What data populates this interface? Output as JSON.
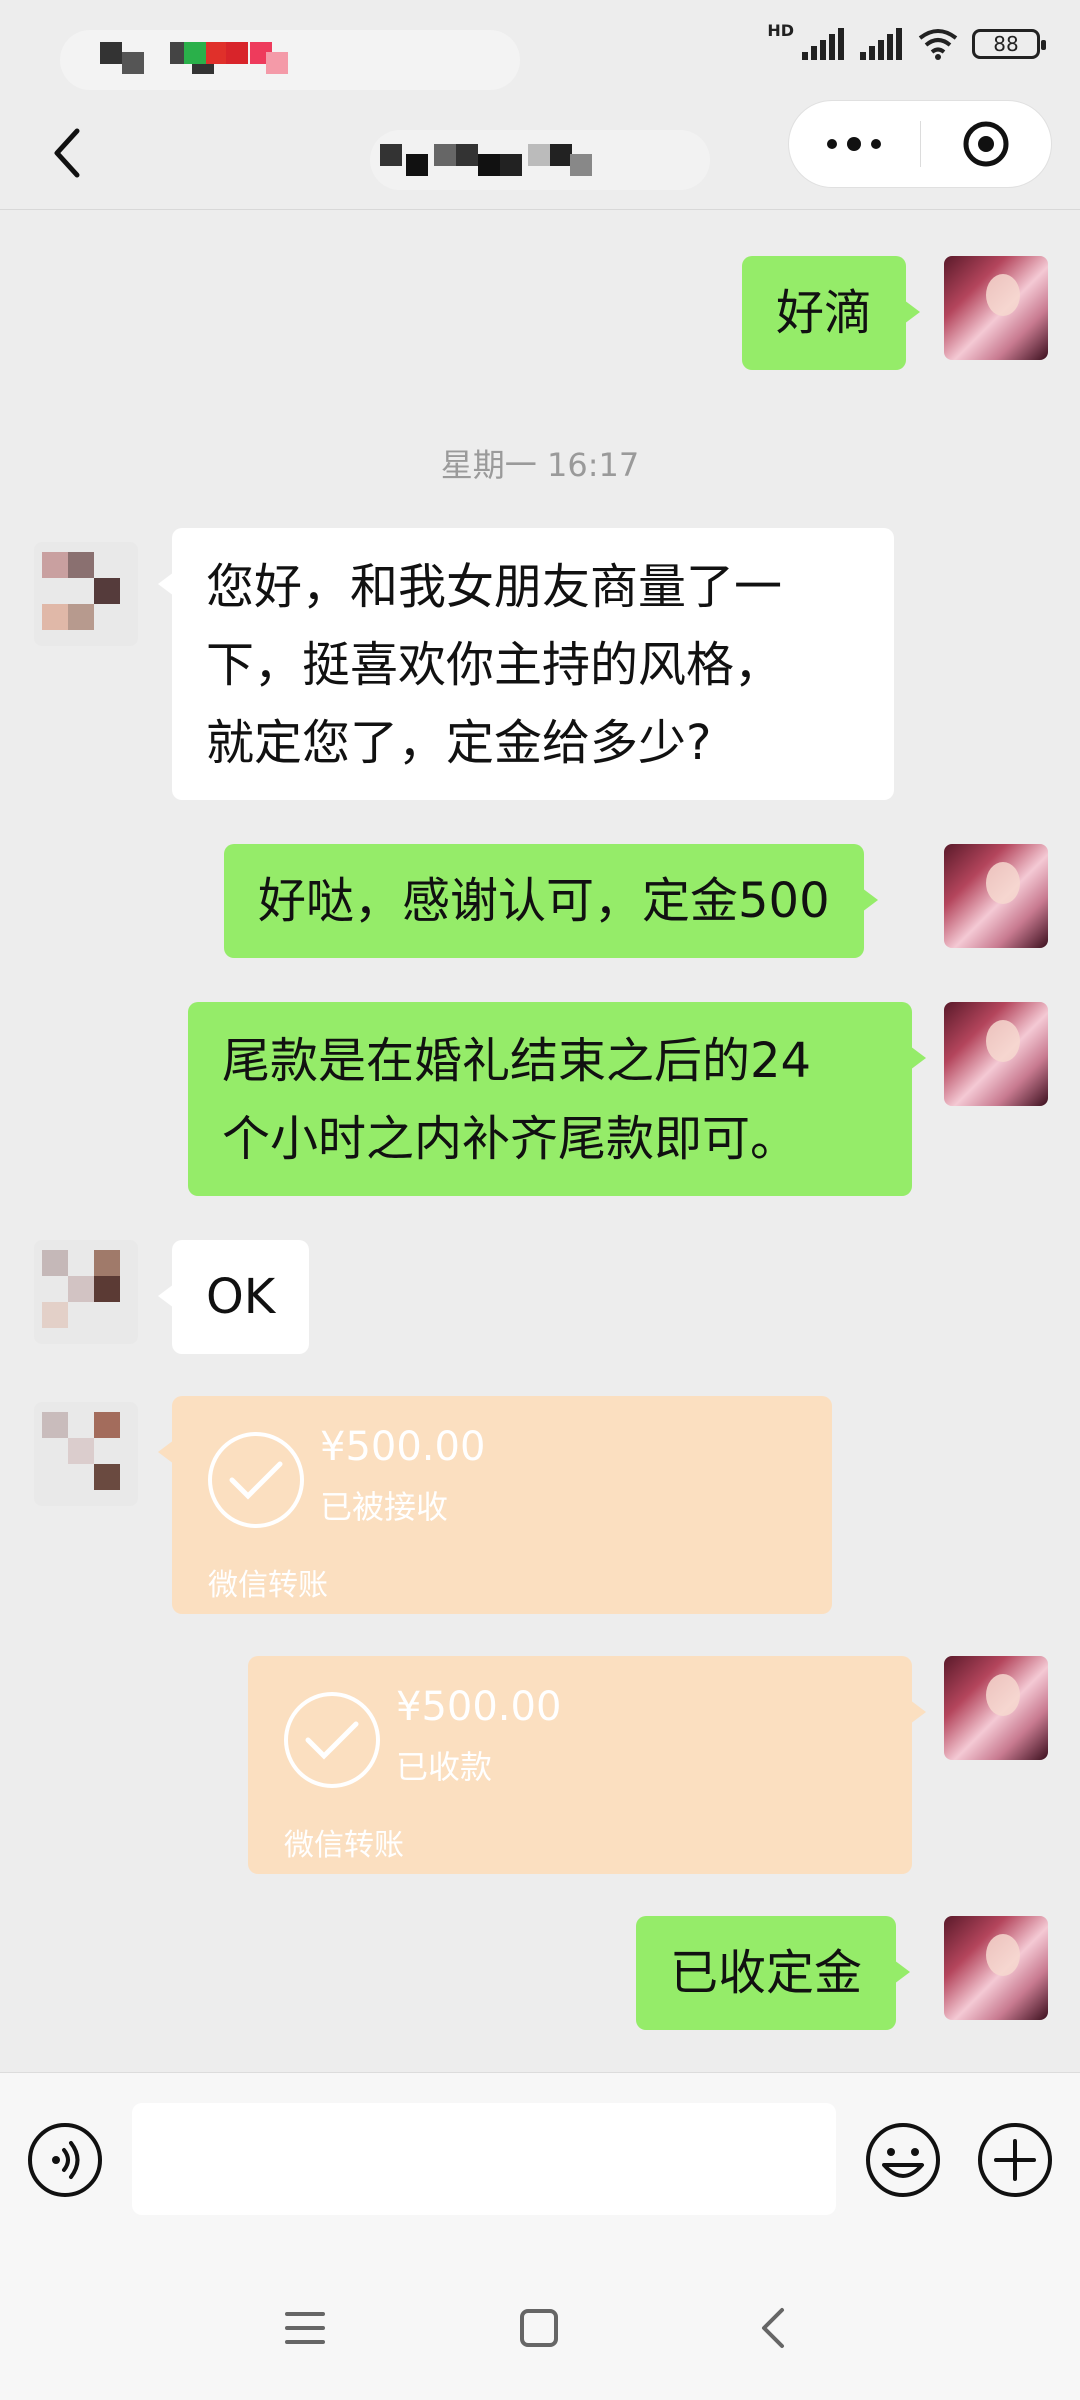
{
  "status_bar": {
    "hd": "HD",
    "battery": "88"
  },
  "timestamp": "星期一 16:17",
  "messages": {
    "m1": "好滴",
    "m2_lines": [
      "您好，和我女朋友商量了一",
      "下，挺喜欢你主持的风格，",
      "就定您了，定金给多少?"
    ],
    "m3": "好哒，感谢认可，定金500",
    "m4_lines": [
      "尾款是在婚礼结束之后的24",
      "个小时之内补齐尾款即可。"
    ],
    "m5": "OK",
    "m8": "已收定金"
  },
  "transfers": {
    "t1": {
      "amount": "¥500.00",
      "status": "已被接收",
      "label": "微信转账"
    },
    "t2": {
      "amount": "¥500.00",
      "status": "已收款",
      "label": "微信转账"
    }
  },
  "input": {
    "value": ""
  },
  "icons": {
    "back": "chevron-left-icon",
    "more": "more-dots-icon",
    "close": "target-icon",
    "voice": "voice-icon",
    "emoji": "emoji-icon",
    "plus": "plus-icon"
  },
  "colors": {
    "bubble_self": "#95ec69",
    "bubble_other": "#ffffff",
    "transfer": "#fbdfc0",
    "background": "#ededed"
  }
}
